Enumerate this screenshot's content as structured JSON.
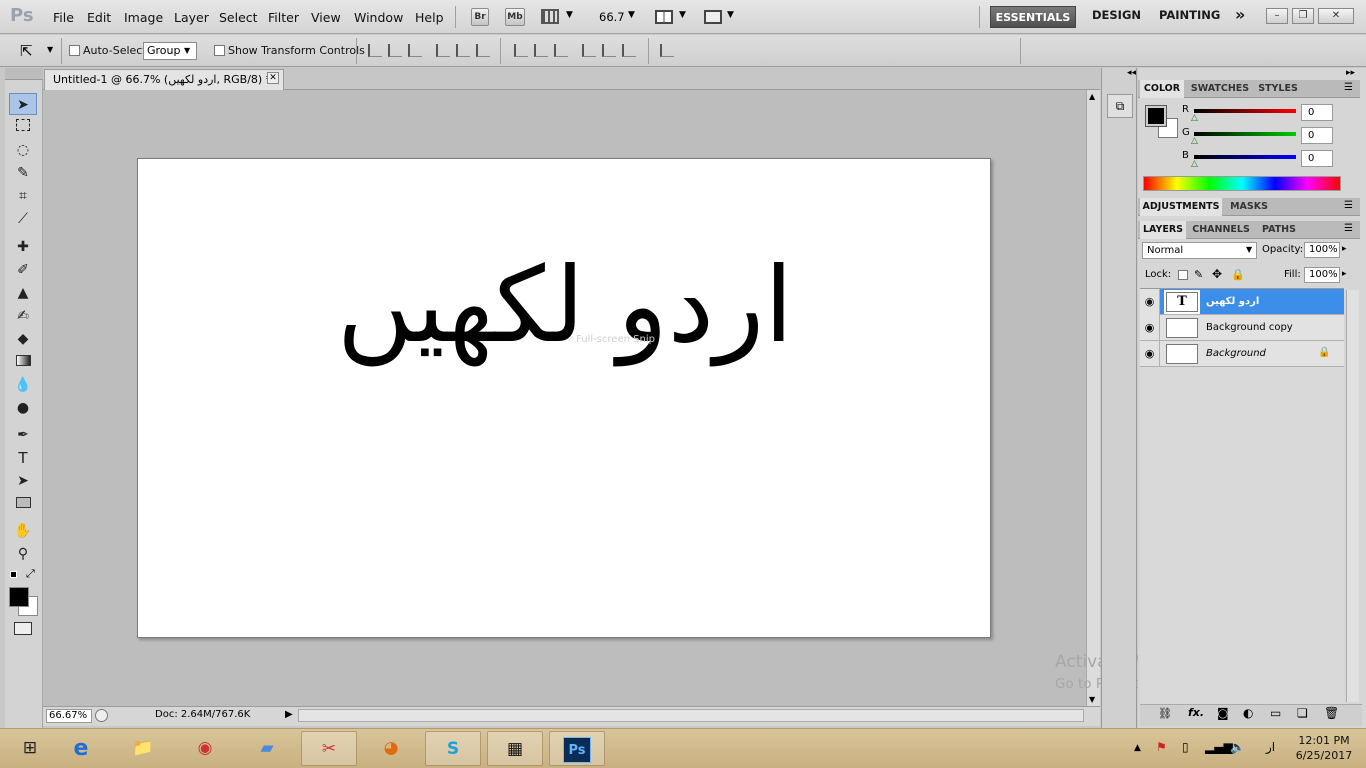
{
  "app": {
    "logo": "Ps"
  },
  "menu": [
    "File",
    "Edit",
    "Image",
    "Layer",
    "Select",
    "Filter",
    "View",
    "Window",
    "Help"
  ],
  "appbar": {
    "bridge": "Br",
    "minibridge": "Mb",
    "zoom": "66.7"
  },
  "workspaces": {
    "active": "ESSENTIALS",
    "design": "DESIGN",
    "painting": "PAINTING",
    "more": "»"
  },
  "window_buttons": {
    "minimize": "–",
    "restore": "❐",
    "close": "✕"
  },
  "options": {
    "auto_select_label": "Auto-Select:",
    "auto_select_value": "Group",
    "transform_label": "Show Transform Controls"
  },
  "document": {
    "tab_title": "Untitled-1 @ 66.7% (اردو لکھیں, RGB/8) *",
    "canvas_text": "اردو لکھیں",
    "snip_hint": "Full-screen Snip"
  },
  "status": {
    "zoom": "66.67%",
    "doc_size": "Doc: 2.64M/767.6K"
  },
  "watermark": {
    "line1": "Activate Windows",
    "line2": "Go to PC settings to activate Windows."
  },
  "panels": {
    "color": {
      "tabs": [
        "COLOR",
        "SWATCHES",
        "STYLES"
      ],
      "r_label": "R",
      "g_label": "G",
      "b_label": "B",
      "r": "0",
      "g": "0",
      "b": "0"
    },
    "adjust": {
      "tabs": [
        "ADJUSTMENTS",
        "MASKS"
      ]
    },
    "layers": {
      "tabs": [
        "LAYERS",
        "CHANNELS",
        "PATHS"
      ],
      "blend_mode": "Normal",
      "opacity_label": "Opacity:",
      "opacity": "100%",
      "lock_label": "Lock:",
      "fill_label": "Fill:",
      "fill": "100%",
      "items": [
        {
          "name": "اردو لکھیں",
          "thumb": "T"
        },
        {
          "name": "Background copy",
          "thumb": ""
        },
        {
          "name": "Background",
          "thumb": ""
        }
      ]
    }
  },
  "tray": {
    "lang": "ار",
    "time": "12:01 PM",
    "date": "6/25/2017"
  },
  "colors": {
    "selection": "#3d8ee8",
    "foreground": "#000000",
    "background": "#ffffff"
  }
}
